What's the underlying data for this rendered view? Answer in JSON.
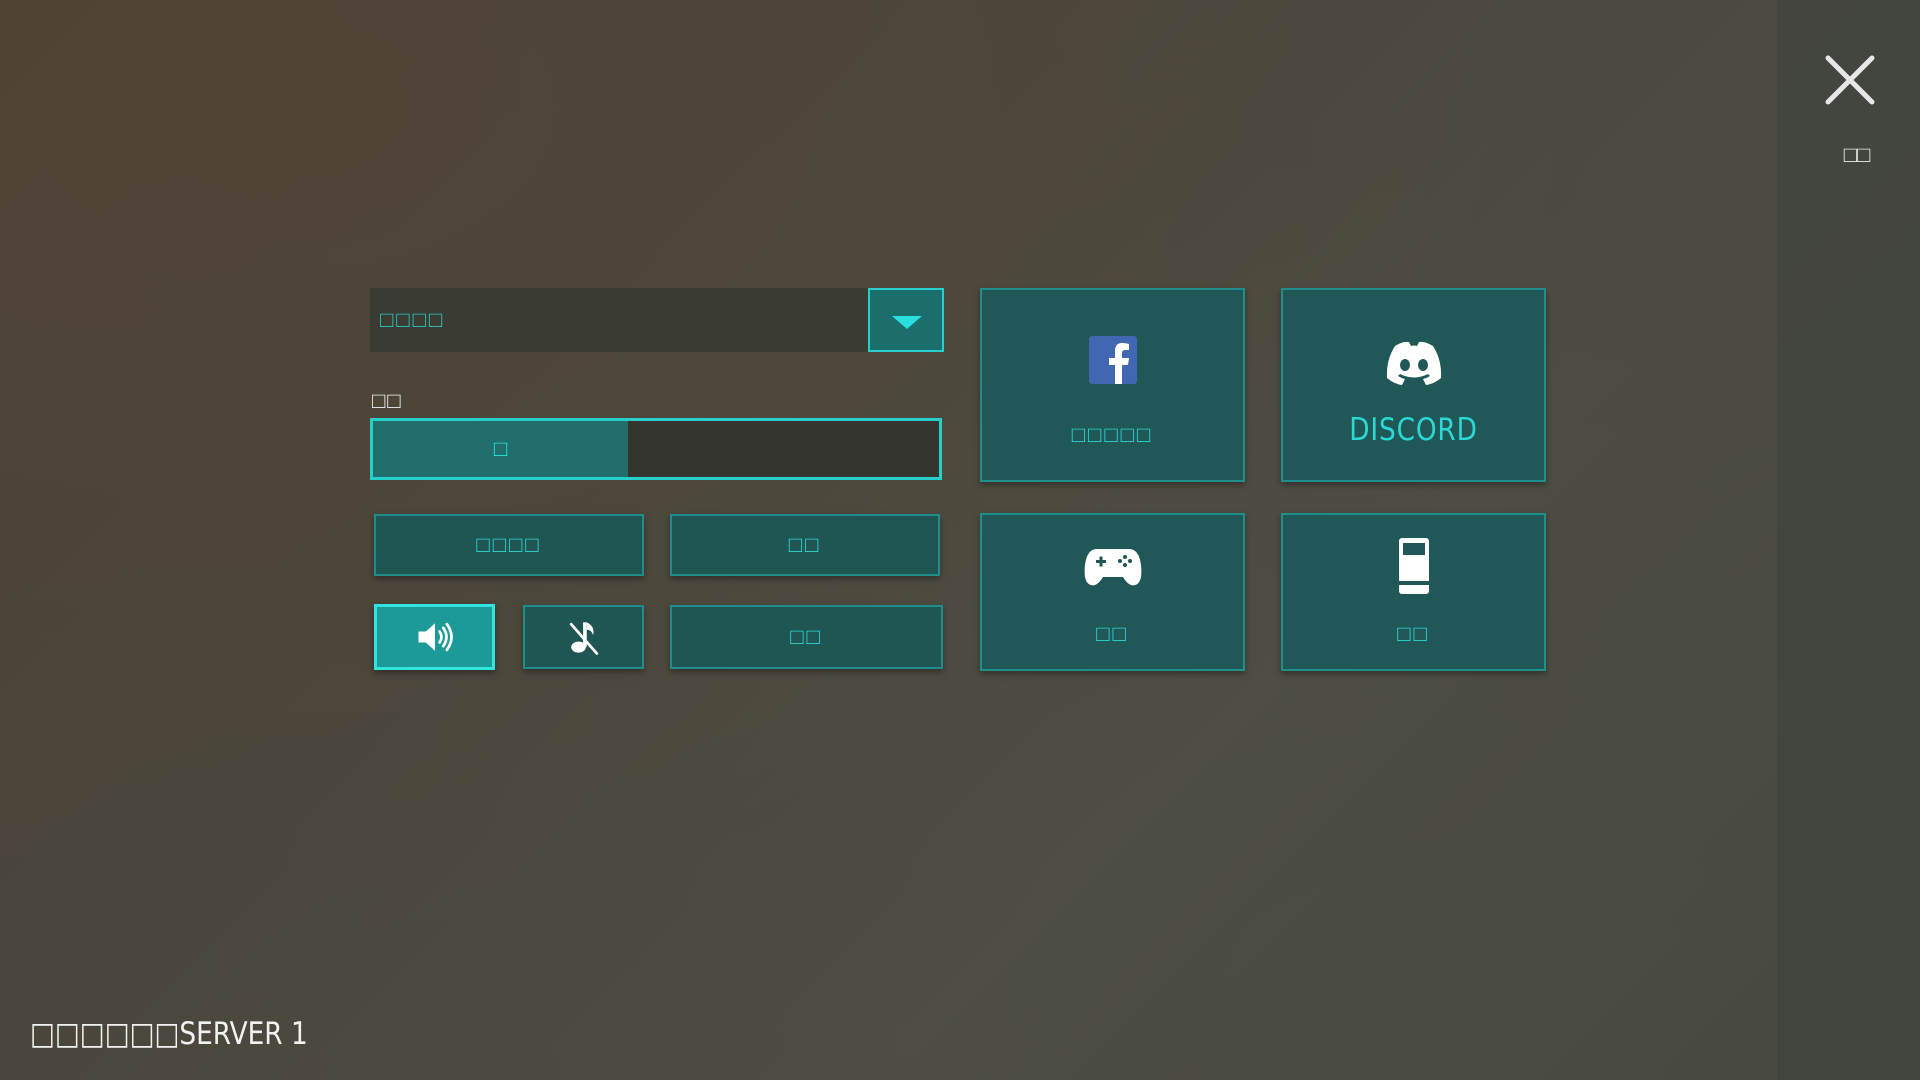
{
  "header": {
    "close_icon": "close-icon",
    "side_label": "□□"
  },
  "settings": {
    "dropdown": {
      "value": "□□□□",
      "icon": "chevron-down-icon"
    },
    "slider": {
      "label": "□□",
      "value_label": "□",
      "level": 0.45
    },
    "buttons": {
      "button_a": "□□□□",
      "button_b": "□□",
      "button_c": "□□",
      "sound_on_icon": "speaker-icon",
      "music_off_icon": "music-off-icon"
    }
  },
  "tiles": {
    "facebook": {
      "label": "□□□□□",
      "icon": "facebook-icon",
      "color": "#4267b2"
    },
    "discord": {
      "label": "DISCORD",
      "icon": "discord-icon"
    },
    "games": {
      "label": "□□",
      "icon": "gamepad-icon"
    },
    "phone": {
      "label": "□□",
      "icon": "phone-icon"
    }
  },
  "footer": {
    "server_text": "□□□□□□SERVER 1"
  },
  "colors": {
    "accent": "#27cfcb",
    "tile_bg": "#1f5856",
    "active_bg": "#1c9a97"
  }
}
